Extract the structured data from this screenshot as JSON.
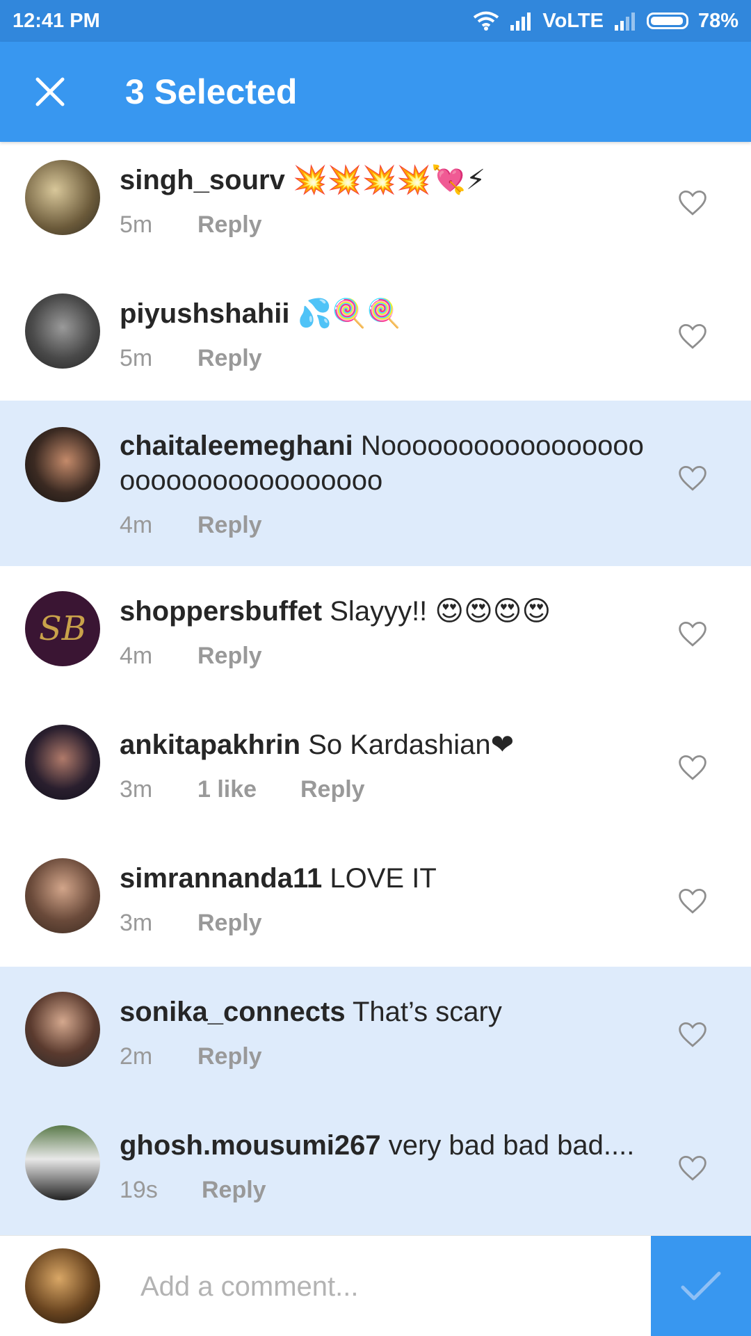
{
  "status_bar": {
    "time": "12:41 PM",
    "network": "VoLTE",
    "battery": "78%"
  },
  "header": {
    "title": "3 Selected"
  },
  "comments": [
    {
      "username": "singh_sourv",
      "text": "💥💥💥💥💘⚡",
      "time": "5m",
      "likes": "",
      "reply": "Reply",
      "selected": false
    },
    {
      "username": "piyushshahii",
      "text": "💦🍭🍭",
      "time": "5m",
      "likes": "",
      "reply": "Reply",
      "selected": false
    },
    {
      "username": "chaitaleemeghani",
      "text": "Noooooooooooooooooooooooooooooooooo",
      "time": "4m",
      "likes": "",
      "reply": "Reply",
      "selected": true
    },
    {
      "username": "shoppersbuffet",
      "text": "Slayyy!! 😍😍😍😍",
      "time": "4m",
      "likes": "",
      "reply": "Reply",
      "selected": false
    },
    {
      "username": "ankitapakhrin",
      "text": "So Kardashian❤",
      "time": "3m",
      "likes": "1 like",
      "reply": "Reply",
      "selected": false
    },
    {
      "username": "simrannanda11",
      "text": "LOVE IT",
      "time": "3m",
      "likes": "",
      "reply": "Reply",
      "selected": false
    },
    {
      "username": "sonika_connects",
      "text": "That’s scary",
      "time": "2m",
      "likes": "",
      "reply": "Reply",
      "selected": true
    },
    {
      "username": "ghosh.mousumi267",
      "text": "very bad bad bad....",
      "time": "19s",
      "likes": "",
      "reply": "Reply",
      "selected": true
    }
  ],
  "composer": {
    "placeholder": "Add a comment..."
  },
  "colors": {
    "accent": "#3897f0",
    "status_bar": "#3187dc",
    "selected_row": "#deebfb"
  }
}
